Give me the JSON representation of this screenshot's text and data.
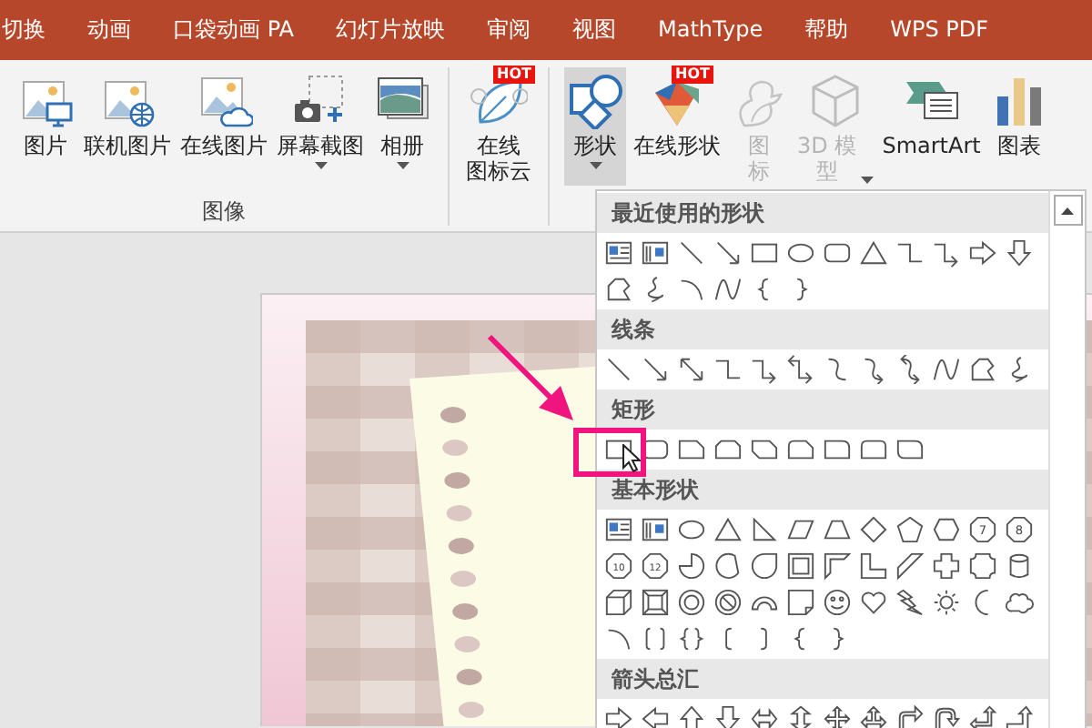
{
  "tabs": [
    {
      "label": "切换",
      "selected": false
    },
    {
      "label": "动画",
      "selected": false
    },
    {
      "label": "口袋动画 PA",
      "selected": false
    },
    {
      "label": "幻灯片放映",
      "selected": false
    },
    {
      "label": "审阅",
      "selected": false
    },
    {
      "label": "视图",
      "selected": false
    },
    {
      "label": "MathType",
      "selected": false
    },
    {
      "label": "帮助",
      "selected": false
    },
    {
      "label": "WPS PDF",
      "selected": false
    }
  ],
  "ribbon": {
    "groups": [
      {
        "label": "图像",
        "buttons": [
          {
            "kind": "picture",
            "label": "图片",
            "dropdown": false,
            "disabled": false,
            "selected": false
          },
          {
            "kind": "online-picture",
            "label": "联机图片",
            "dropdown": false,
            "disabled": false,
            "selected": false
          },
          {
            "kind": "cloud-picture",
            "label": "在线图片",
            "dropdown": false,
            "disabled": false,
            "selected": false
          },
          {
            "kind": "screenshot",
            "label": "屏幕截图",
            "dropdown": true,
            "disabled": false,
            "selected": false
          },
          {
            "kind": "album",
            "label": "相册",
            "dropdown": true,
            "disabled": false,
            "selected": false
          }
        ]
      },
      {
        "buttons": [
          {
            "kind": "leaf",
            "label_lines": [
              "在线",
              "图标云"
            ],
            "badge": "HOT",
            "dropdown": false,
            "disabled": false,
            "selected": false
          }
        ]
      },
      {
        "buttons": [
          {
            "kind": "shapes",
            "label": "形状",
            "dropdown": true,
            "disabled": false,
            "selected": true
          },
          {
            "kind": "online-shapes",
            "label": "在线形状",
            "badge": "HOT",
            "dropdown": false,
            "disabled": false,
            "selected": false
          },
          {
            "kind": "icons",
            "label_lines": [
              "图",
              "标"
            ],
            "dropdown": false,
            "disabled": true,
            "selected": false
          },
          {
            "kind": "cube",
            "label_lines": [
              "3D 模",
              "型"
            ],
            "dropdown": true,
            "disabled": true,
            "selected": false
          },
          {
            "kind": "smartart",
            "label": "SmartArt",
            "dropdown": false,
            "disabled": false,
            "selected": false
          },
          {
            "kind": "chart",
            "label": "图表",
            "dropdown": false,
            "disabled": false,
            "selected": false
          }
        ]
      }
    ]
  },
  "shape_gallery": {
    "sections": [
      {
        "title": "最近使用的形状",
        "shapes": [
          {
            "kind": "textbox"
          },
          {
            "kind": "vtextbox"
          },
          {
            "kind": "line"
          },
          {
            "kind": "arrow-line"
          },
          {
            "kind": "rect"
          },
          {
            "kind": "oval"
          },
          {
            "kind": "rounded-rect"
          },
          {
            "kind": "triangle"
          },
          {
            "kind": "elbow"
          },
          {
            "kind": "elbow-arrow"
          },
          {
            "kind": "right-arrow"
          },
          {
            "kind": "down-arrow"
          },
          {
            "kind": "freeform"
          },
          {
            "kind": "scribble"
          },
          {
            "kind": "arc"
          },
          {
            "kind": "curve"
          },
          {
            "kind": "brace-left"
          },
          {
            "kind": "brace-right"
          }
        ]
      },
      {
        "title": "线条",
        "shapes": [
          {
            "kind": "line"
          },
          {
            "kind": "arrow-line"
          },
          {
            "kind": "double-arrow-line"
          },
          {
            "kind": "elbow"
          },
          {
            "kind": "elbow-arrow"
          },
          {
            "kind": "elbow-double-arrow"
          },
          {
            "kind": "curve-connector"
          },
          {
            "kind": "curve-arrow"
          },
          {
            "kind": "curve-double-arrow"
          },
          {
            "kind": "curve"
          },
          {
            "kind": "freeform"
          },
          {
            "kind": "scribble"
          }
        ]
      },
      {
        "title": "矩形",
        "shapes": [
          {
            "kind": "rect"
          },
          {
            "kind": "rounded-rect"
          },
          {
            "kind": "snip-one"
          },
          {
            "kind": "snip-same"
          },
          {
            "kind": "snip-diag"
          },
          {
            "kind": "snip-round"
          },
          {
            "kind": "round-one"
          },
          {
            "kind": "round-same"
          },
          {
            "kind": "round-diag"
          }
        ]
      },
      {
        "title": "基本形状",
        "shapes": [
          {
            "kind": "textbox"
          },
          {
            "kind": "vtextbox"
          },
          {
            "kind": "oval"
          },
          {
            "kind": "triangle"
          },
          {
            "kind": "right-triangle"
          },
          {
            "kind": "parallelogram"
          },
          {
            "kind": "trapezoid"
          },
          {
            "kind": "diamond"
          },
          {
            "kind": "pentagon"
          },
          {
            "kind": "hexagon"
          },
          {
            "kind": "numbered-polygon",
            "label": "7"
          },
          {
            "kind": "numbered-polygon",
            "label": "8"
          },
          {
            "kind": "numbered-polygon",
            "label": "10"
          },
          {
            "kind": "numbered-polygon",
            "label": "12"
          },
          {
            "kind": "pie"
          },
          {
            "kind": "chord"
          },
          {
            "kind": "teardrop"
          },
          {
            "kind": "frame"
          },
          {
            "kind": "half-frame"
          },
          {
            "kind": "l-shape"
          },
          {
            "kind": "diagonal-stripe"
          },
          {
            "kind": "cross"
          },
          {
            "kind": "plaque"
          },
          {
            "kind": "can"
          },
          {
            "kind": "cube"
          },
          {
            "kind": "bevel"
          },
          {
            "kind": "donut"
          },
          {
            "kind": "no-symbol"
          },
          {
            "kind": "block-arc"
          },
          {
            "kind": "folded-corner"
          },
          {
            "kind": "smiley"
          },
          {
            "kind": "heart"
          },
          {
            "kind": "lightning"
          },
          {
            "kind": "sun"
          },
          {
            "kind": "moon"
          },
          {
            "kind": "cloud"
          },
          {
            "kind": "arc"
          },
          {
            "kind": "double-bracket"
          },
          {
            "kind": "double-brace"
          },
          {
            "kind": "left-bracket"
          },
          {
            "kind": "right-bracket"
          },
          {
            "kind": "brace-left"
          },
          {
            "kind": "brace-right"
          }
        ]
      },
      {
        "title": "箭头总汇",
        "shapes": [
          {
            "kind": "right-arrow"
          },
          {
            "kind": "left-arrow"
          },
          {
            "kind": "up-arrow"
          },
          {
            "kind": "down-arrow"
          },
          {
            "kind": "left-right-arrow"
          },
          {
            "kind": "up-down-arrow"
          },
          {
            "kind": "quad-arrow"
          },
          {
            "kind": "left-right-up-arrow"
          },
          {
            "kind": "bent-arrow"
          },
          {
            "kind": "u-turn-arrow"
          },
          {
            "kind": "left-up-arrow"
          },
          {
            "kind": "bent-up-arrow"
          }
        ]
      }
    ]
  }
}
